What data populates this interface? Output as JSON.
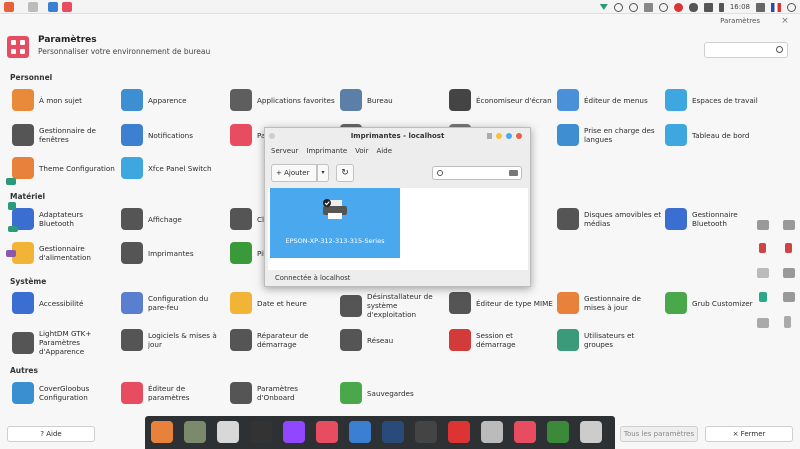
{
  "window": {
    "title": "Paramètres",
    "close": "×"
  },
  "header": {
    "title": "Paramètres",
    "subtitle": "Personnaliser votre environnement de bureau"
  },
  "clock": "16:08",
  "sections": {
    "personnel": "Personnel",
    "materiel": "Matériel",
    "systeme": "Système",
    "autres": "Autres"
  },
  "personnel": [
    {
      "label": "À mon sujet",
      "color": "#e88a3a"
    },
    {
      "label": "Apparence",
      "color": "#3d8fd1"
    },
    {
      "label": "Applications favorites",
      "color": "#5e5e5e"
    },
    {
      "label": "Bureau",
      "color": "#5b7fa6"
    },
    {
      "label": "Économiseur d'écran",
      "color": "#444"
    },
    {
      "label": "Éditeur de menus",
      "color": "#4a90d9"
    },
    {
      "label": "Espaces de travail",
      "color": "#3fa7e0"
    },
    {
      "label": "Gestionnaire de fenêtres",
      "color": "#555"
    },
    {
      "label": "Notifications",
      "color": "#3d7fd1"
    },
    {
      "label": "Paramètres xfce",
      "color": "#e84c61"
    },
    {
      "label": "Pavé tactile",
      "color": "#666"
    },
    {
      "label": "Personnaliser",
      "color": "#777"
    },
    {
      "label": "Prise en charge des langues",
      "color": "#3d8fd1"
    },
    {
      "label": "Tableau de bord",
      "color": "#3fa7e0"
    },
    {
      "label": "Theme Configuration",
      "color": "#e8823a"
    },
    {
      "label": "Xfce Panel Switch",
      "color": "#3fa7e0"
    }
  ],
  "materiel": [
    {
      "label": "Adaptateurs Bluetooth",
      "color": "#3a6fd1"
    },
    {
      "label": "Affichage",
      "color": "#555"
    },
    {
      "label": "Clavier",
      "color": "#555"
    },
    {
      "label": "Disques amovibles et médias",
      "color": "#555"
    },
    {
      "label": "Gestionnaire Bluetooth",
      "color": "#3a6fd1"
    },
    {
      "label": "Gestionnaire d'alimentation",
      "color": "#f2b437"
    },
    {
      "label": "Imprimantes",
      "color": "#555"
    },
    {
      "label": "Pilotes",
      "color": "#3a9a3a"
    }
  ],
  "systeme": [
    {
      "label": "Accessibilité",
      "color": "#3a6fd1"
    },
    {
      "label": "Configuration du pare-feu",
      "color": "#5a7fd1"
    },
    {
      "label": "Date et heure",
      "color": "#f2b437"
    },
    {
      "label": "Désinstallateur de système d'exploitation",
      "color": "#555"
    },
    {
      "label": "Éditeur de type MIME",
      "color": "#555"
    },
    {
      "label": "Gestionnaire de mises à jour",
      "color": "#e8823a"
    },
    {
      "label": "Grub Customizer",
      "color": "#4aa84a"
    },
    {
      "label": "LightDM GTK+ Paramètres d'Apparence",
      "color": "#555"
    },
    {
      "label": "Logiciels & mises à jour",
      "color": "#555"
    },
    {
      "label": "Réparateur de démarrage",
      "color": "#555"
    },
    {
      "label": "Réseau",
      "color": "#555"
    },
    {
      "label": "Session et démarrage",
      "color": "#d33a3a"
    },
    {
      "label": "Utilisateurs et groupes",
      "color": "#3a9a7a"
    }
  ],
  "autres": [
    {
      "label": "CoverGloobus Configuration",
      "color": "#3a8fd1"
    },
    {
      "label": "Éditeur de paramètres",
      "color": "#e84c61"
    },
    {
      "label": "Paramètres d'Onboard",
      "color": "#555"
    },
    {
      "label": "Sauvegardes",
      "color": "#4aa84a"
    }
  ],
  "dialog": {
    "title": "Imprimantes - localhost",
    "menu": [
      "Serveur",
      "Imprimante",
      "Voir",
      "Aide"
    ],
    "add_label": "+  Ajouter",
    "add_arrow": "▾",
    "refresh": "↻",
    "printer": "EPSON-XP-312-313-315-Series",
    "status": "Connectée à localhost"
  },
  "footer": {
    "help": "? Aide",
    "all": "Tous les paramètres",
    "close": "× Fermer"
  },
  "dock": [
    {
      "name": "firefox-icon",
      "color": "#e8823a"
    },
    {
      "name": "files-icon",
      "color": "#7a8a6a"
    },
    {
      "name": "editor-icon",
      "color": "#d8d8d8"
    },
    {
      "name": "terminal-icon",
      "color": "#333"
    },
    {
      "name": "twitch-icon",
      "color": "#9147ff"
    },
    {
      "name": "settings-icon",
      "color": "#e84c61"
    },
    {
      "name": "display-icon",
      "color": "#3a7fd1"
    },
    {
      "name": "steam-icon",
      "color": "#2a4a7a"
    },
    {
      "name": "recorder-icon",
      "color": "#444"
    },
    {
      "name": "youtube-icon",
      "color": "#d33"
    },
    {
      "name": "archive-icon",
      "color": "#bbb"
    },
    {
      "name": "config-icon",
      "color": "#e84c61"
    },
    {
      "name": "trash-icon",
      "color": "#3a8a3a"
    },
    {
      "name": "printer-icon",
      "color": "#ccc"
    }
  ]
}
